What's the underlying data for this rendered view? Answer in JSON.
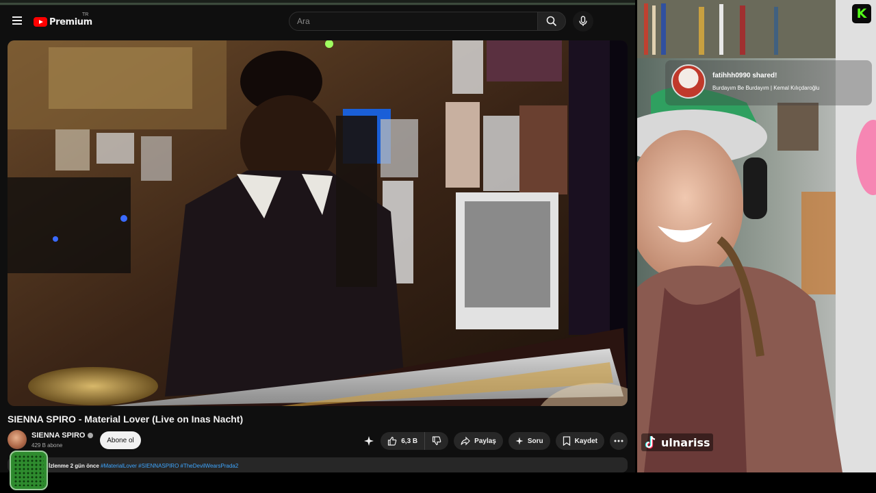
{
  "youtube": {
    "logo_text": "Premium",
    "logo_country": "TR",
    "search": {
      "placeholder": "Ara",
      "value": ""
    },
    "video": {
      "title": "SIENNA SPIRO - Material Lover (Live on Inas Nacht)",
      "channel": {
        "name": "SIENNA SPIRO",
        "subscribers": "429 B abone"
      },
      "subscribe_label": "Abone ol",
      "actions": {
        "likes": "6,3 B",
        "share_label": "Paylaş",
        "ask_label": "Soru",
        "save_label": "Kaydet"
      },
      "description": {
        "meta": "İzlenme  2 gün önce",
        "tags": "#MaterialLover #SIENNASPIRO #TheDevilWearsPrada2"
      }
    }
  },
  "stream_overlay": {
    "share_alert": {
      "user": "fatihhh0990 shared!",
      "song": "Burdayım Be Burdayım | Kemal Kılıçdaroğlu"
    },
    "platform_badge": "K",
    "handle": "ulnariss"
  },
  "colors": {
    "youtube_red": "#ff0000",
    "kick_green": "#53fc18",
    "background": "#0f0f0f",
    "pill": "#272727",
    "link_blue": "#3ea6ff"
  },
  "icons": [
    "menu-icon",
    "youtube-logo-icon",
    "search-icon",
    "microphone-icon",
    "verified-icon",
    "sparkle-icon",
    "thumbs-up-icon",
    "thumbs-down-icon",
    "share-icon",
    "ask-icon",
    "save-icon",
    "more-icon",
    "tiktok-icon",
    "kick-icon"
  ]
}
